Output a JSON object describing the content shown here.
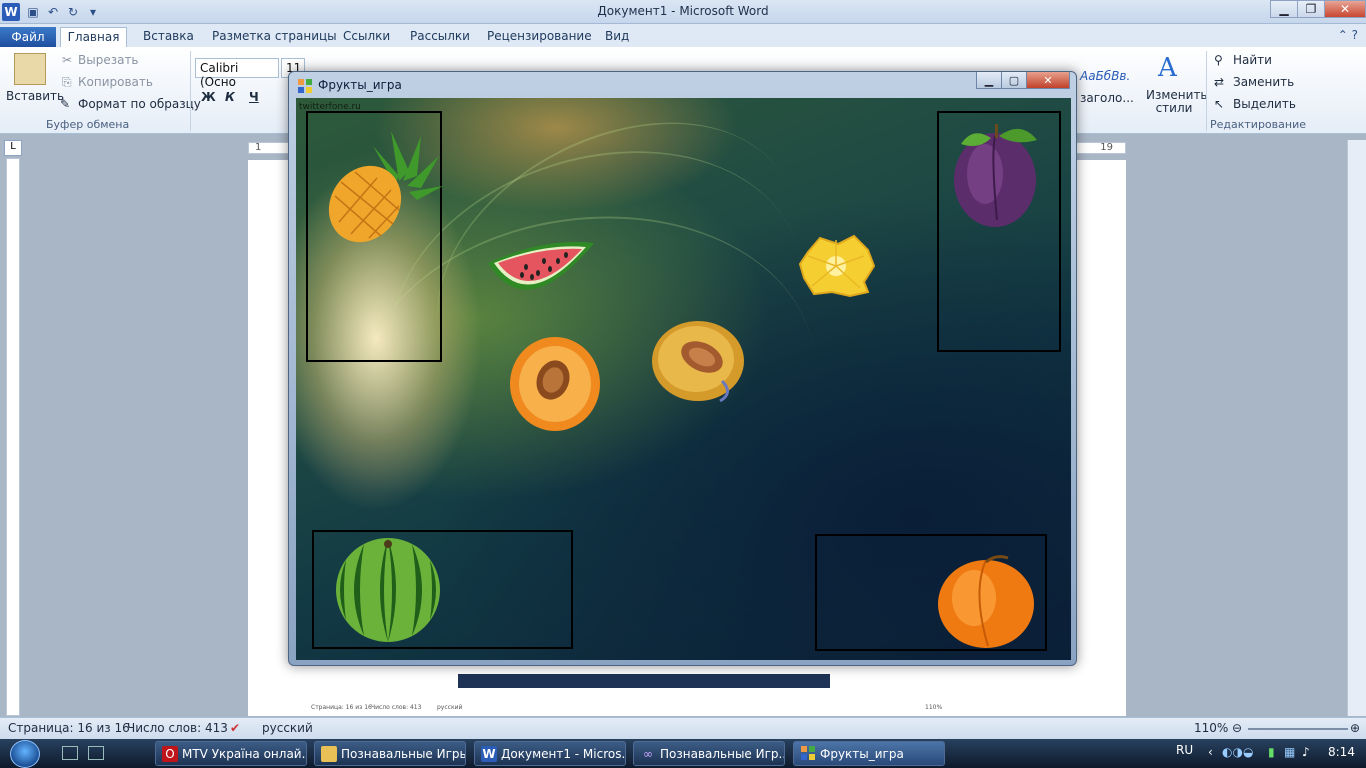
{
  "word": {
    "window_title": "Документ1 - Microsoft Word",
    "app_letter": "W",
    "tabs": [
      "Файл",
      "Главная",
      "Вставка",
      "Разметка страницы",
      "Ссылки",
      "Рассылки",
      "Рецензирование",
      "Вид"
    ],
    "clipboard": {
      "paste": "Вставить",
      "cut": "Вырезать",
      "copy": "Копировать",
      "format_painter": "Формат по образцу",
      "group": "Буфер обмена"
    },
    "font": {
      "name": "Calibri (Осно",
      "size": "11",
      "bold": "Ж",
      "italic": "К",
      "underline": "Ч"
    },
    "styles": {
      "sample_text": "АаБбВв.",
      "heading_hint": "заголо...",
      "change_styles": "Изменить стили"
    },
    "editing": {
      "find": "Найти",
      "replace": "Заменить",
      "select": "Выделить",
      "group": "Редактирование"
    },
    "ruler_start": "1",
    "ruler_end": "19",
    "status": {
      "page": "Страница: 16 из 16",
      "words": "Число слов: 413",
      "language": "русский",
      "zoom": "110%"
    }
  },
  "app": {
    "title": "Фрукты_игра",
    "watermark": "twitterfone.ru"
  },
  "fruits": [
    "pineapple",
    "watermelon-slice",
    "pineapple-slice",
    "plum",
    "peach-half",
    "apricot-half",
    "watermelon",
    "peach"
  ],
  "embedded_shot": {
    "page": "Страница: 16 из 16",
    "words": "Число слов: 413",
    "language": "русский",
    "zoom": "110%"
  },
  "taskbar": {
    "items": [
      {
        "label": "MTV Україна онлай...",
        "icon": "opera-icon"
      },
      {
        "label": "Познавальные Игры",
        "icon": "folder-icon"
      },
      {
        "label": "Документ1 - Micros...",
        "icon": "word-icon"
      },
      {
        "label": "Познавальные Игр...",
        "icon": "vs-icon"
      },
      {
        "label": "Фрукты_игра",
        "icon": "app-icon"
      }
    ],
    "lang": "RU",
    "time": "8:14"
  },
  "colors": {
    "accent": "#2b5cb8",
    "taskbar": "#0e1a2c",
    "ribbon_bg": "#e5edf7"
  }
}
